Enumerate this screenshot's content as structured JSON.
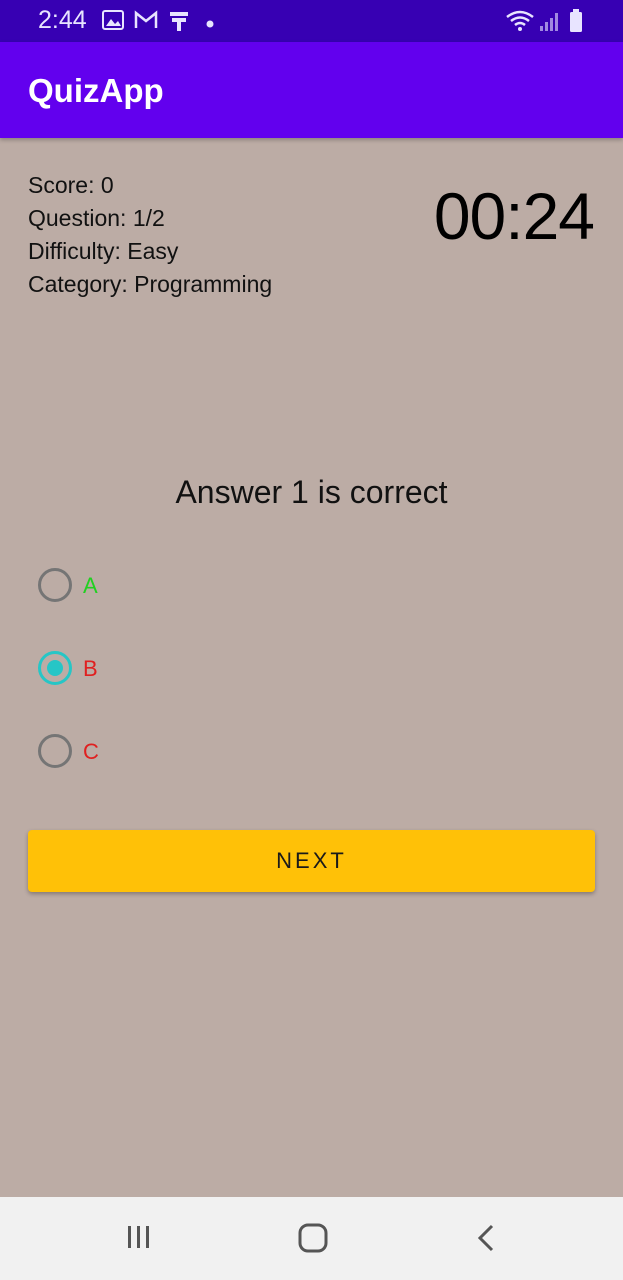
{
  "status_bar": {
    "time": "2:44",
    "left_icons": [
      "gallery-icon",
      "gmail-icon",
      "signal-booster-icon",
      "notification-dot-icon"
    ],
    "right_icons": [
      "wifi-icon",
      "cell-signal-icon",
      "battery-icon"
    ]
  },
  "app_bar": {
    "title": "QuizApp",
    "color": "#6200ee"
  },
  "stats": {
    "score": "Score: 0",
    "question": "Question: 1/2",
    "difficulty": "Difficulty: Easy",
    "category": "Category: Programming"
  },
  "timer": "00:24",
  "question_text": "Answer 1 is correct",
  "options": [
    {
      "label": "A",
      "checked": false,
      "color": "#21d021"
    },
    {
      "label": "B",
      "checked": true,
      "color": "#e02020"
    },
    {
      "label": "C",
      "checked": false,
      "color": "#e02020"
    }
  ],
  "next_button": {
    "label": "NEXT",
    "color": "#ffc107"
  },
  "nav_bar": {
    "buttons": [
      "recent-apps-icon",
      "home-icon",
      "back-icon"
    ]
  },
  "colors": {
    "background": "#bcaca5",
    "accent": "#26c6c6",
    "status_bar": "#3700b3"
  }
}
